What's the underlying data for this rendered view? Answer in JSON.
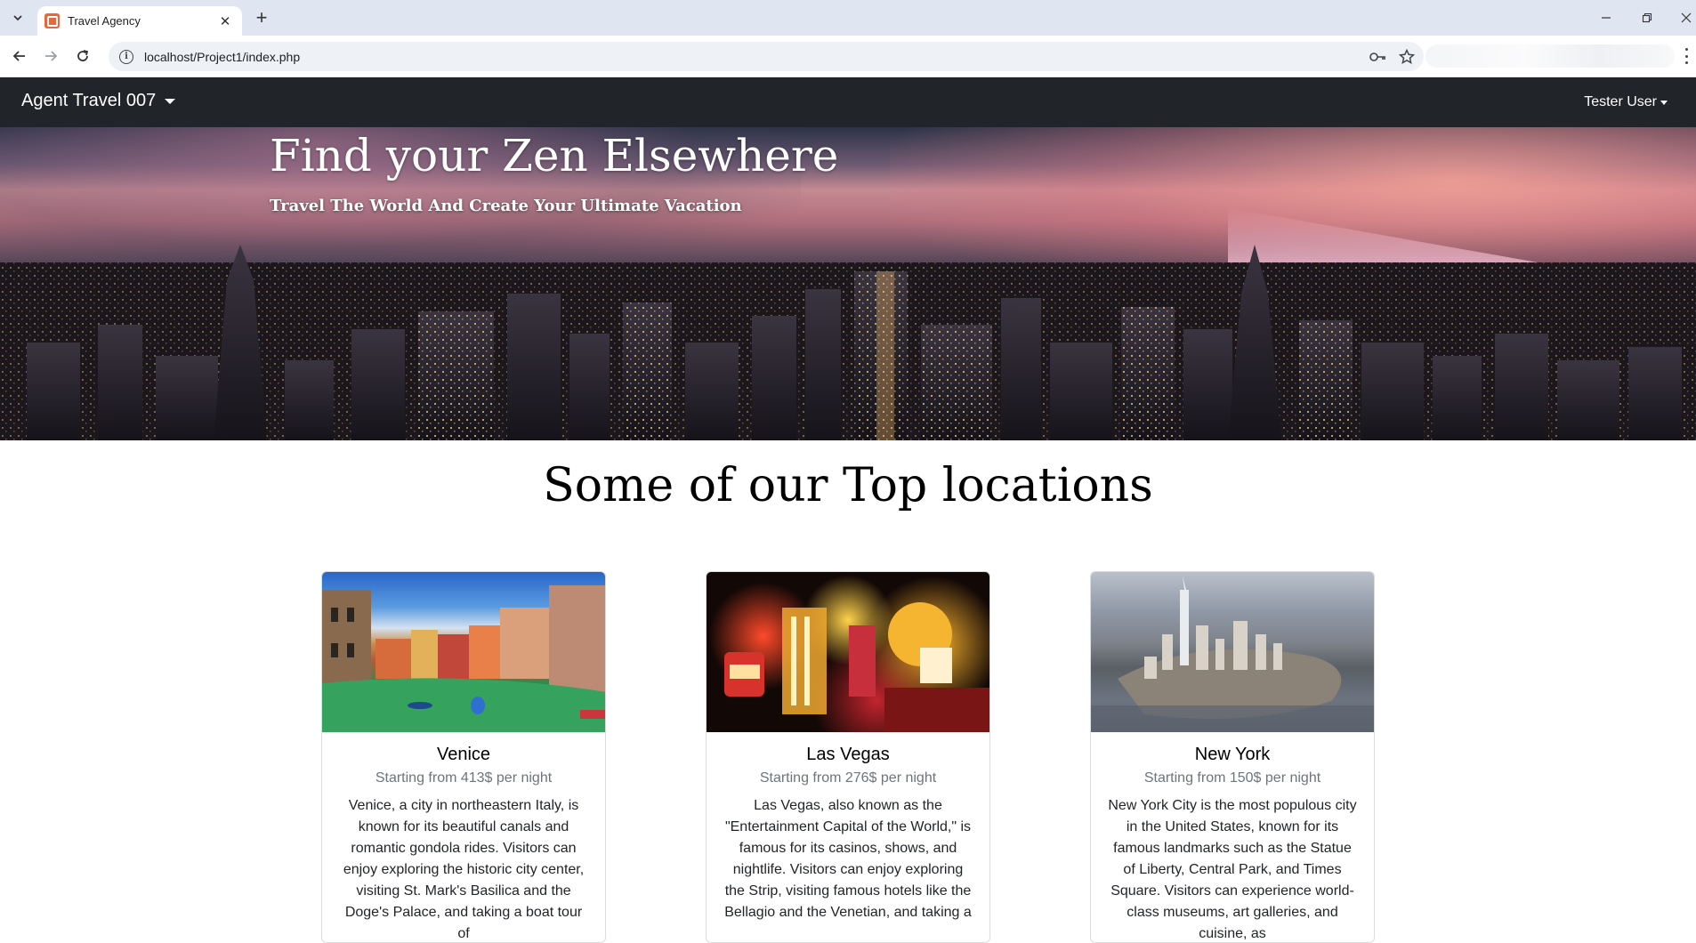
{
  "browser": {
    "tab_title": "Travel Agency",
    "tab_close": "✕",
    "new_tab": "+",
    "url": "localhost/Project1/index.php",
    "window_controls": {
      "minimize": "—",
      "restore": "❐",
      "close": "✕"
    }
  },
  "navbar": {
    "brand": "Agent Travel 007",
    "user": "Tester User",
    "bg_color": "#212529"
  },
  "hero": {
    "title": "Find your Zen Elsewhere",
    "subtitle": "Travel The World And Create Your Ultimate Vacation"
  },
  "section": {
    "title": "Some of our Top locations"
  },
  "cards": [
    {
      "title": "Venice",
      "price": "Starting from 413$ per night",
      "text": "Venice, a city in northeastern Italy, is known for its beautiful canals and romantic gondola rides. Visitors can enjoy exploring the historic city center, visiting St. Mark's Basilica and the Doge's Palace, and taking a boat tour of"
    },
    {
      "title": "Las Vegas",
      "price": "Starting from 276$ per night",
      "text": "Las Vegas, also known as the \"Entertainment Capital of the World,\" is famous for its casinos, shows, and nightlife. Visitors can enjoy exploring the Strip, visiting famous hotels like the Bellagio and the Venetian, and taking a"
    },
    {
      "title": "New York",
      "price": "Starting from 150$ per night",
      "text": "New York City is the most populous city in the United States, known for its famous landmarks such as the Statue of Liberty, Central Park, and Times Square. Visitors can experience world-class museums, art galleries, and cuisine, as"
    }
  ]
}
